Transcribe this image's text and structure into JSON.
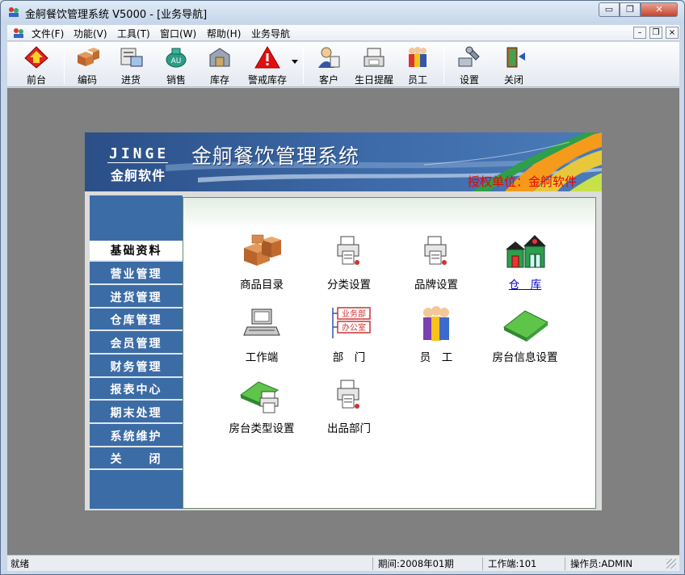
{
  "window": {
    "title": "金舸餐饮管理系统 V5000 - [业务导航]",
    "min_symbol": "▭",
    "max_symbol": "❐",
    "close_symbol": "✕"
  },
  "menubar": {
    "items": [
      "文件(F)",
      "功能(V)",
      "工具(T)",
      "窗口(W)",
      "帮助(H)",
      "业务导航"
    ],
    "mdi": [
      "–",
      "❐",
      "×"
    ]
  },
  "toolbar": {
    "buttons": [
      {
        "label": "前台",
        "icon": "front-desk-icon"
      },
      {
        "label": "编码",
        "icon": "boxes-icon"
      },
      {
        "label": "进货",
        "icon": "purchase-icon"
      },
      {
        "label": "销售",
        "icon": "sales-icon"
      },
      {
        "label": "库存",
        "icon": "inventory-icon"
      },
      {
        "label": "警戒库存",
        "icon": "warning-icon"
      },
      {
        "label": "客户",
        "icon": "customer-icon"
      },
      {
        "label": "生日提醒",
        "icon": "birthday-icon"
      },
      {
        "label": "员工",
        "icon": "staff-icon"
      },
      {
        "label": "设置",
        "icon": "settings-icon"
      },
      {
        "label": "关闭",
        "icon": "exit-door-icon"
      }
    ]
  },
  "banner": {
    "brand_en": "JINGE",
    "brand_cn": "金舸软件",
    "system_title": "金舸餐饮管理系统",
    "license": "授权单位：金舸软件"
  },
  "sidebar": {
    "items": [
      "基础资料",
      "营业管理",
      "进货管理",
      "仓库管理",
      "会员管理",
      "财务管理",
      "报表中心",
      "期末处理",
      "系统维护",
      "关　　闭"
    ],
    "active_index": 0
  },
  "modules": [
    {
      "label": "商品目录",
      "icon": "boxes-icon"
    },
    {
      "label": "分类设置",
      "icon": "printer-doc-icon"
    },
    {
      "label": "品牌设置",
      "icon": "printer-doc-icon"
    },
    {
      "label": "仓　库",
      "icon": "warehouse-icon"
    },
    {
      "label": "工作端",
      "icon": "terminal-icon"
    },
    {
      "label": "部　门",
      "icon": "org-chart-icon"
    },
    {
      "label": "员　工",
      "icon": "staff-icon"
    },
    {
      "label": "房台信息设置",
      "icon": "green-card-icon"
    },
    {
      "label": "房台类型设置",
      "icon": "green-card-doc-icon"
    },
    {
      "label": "出品部门",
      "icon": "printer-doc-icon"
    }
  ],
  "org_chart": {
    "top": "业务部",
    "bottom": "办公室"
  },
  "statusbar": {
    "status": "就绪",
    "period": "期间:2008年01期",
    "terminal": "工作端:101",
    "operator": "操作员:ADMIN"
  },
  "colors": {
    "banner_blue": "#2b4f87",
    "sidebar_blue": "#3c6ca6",
    "license_red": "#e00000",
    "link_blue": "#0000c8"
  }
}
